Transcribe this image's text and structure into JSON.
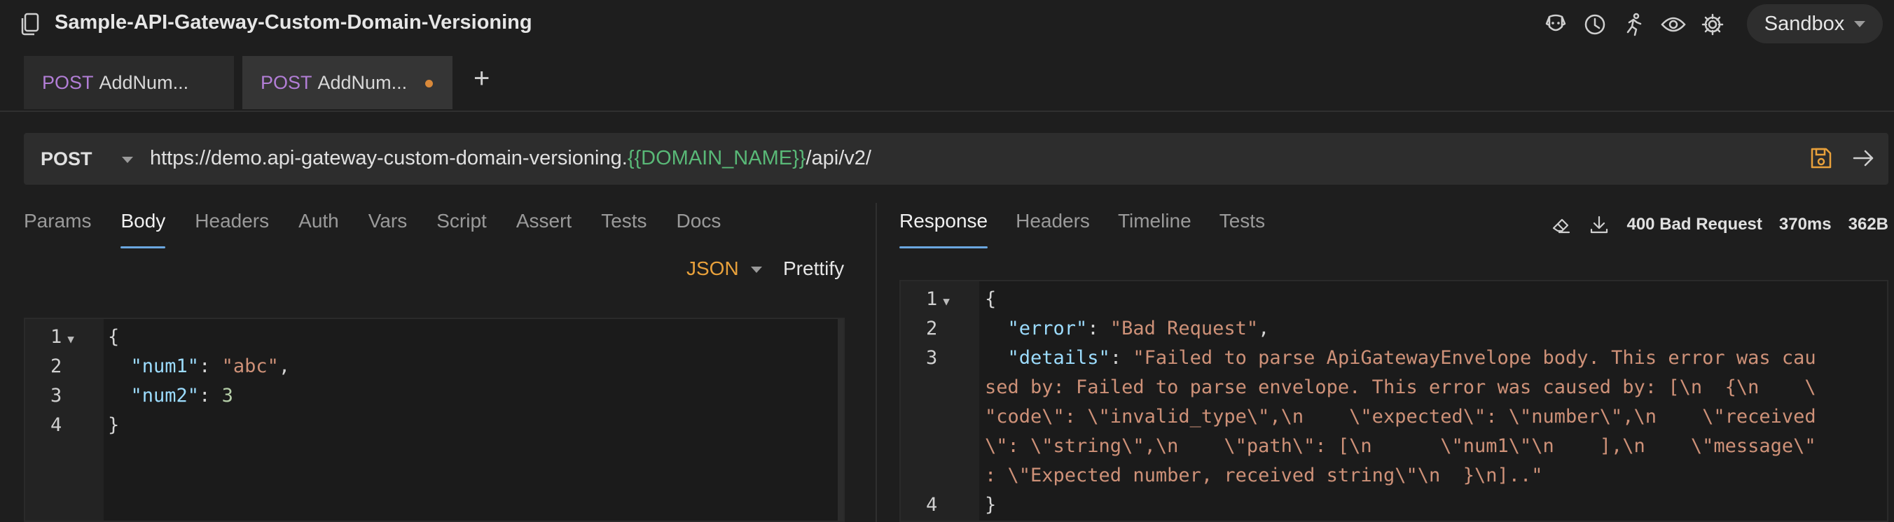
{
  "collection": {
    "title": "Sample-API-Gateway-Custom-Domain-Versioning"
  },
  "header_icons": [
    "dog-icon",
    "clock-icon",
    "runner-icon",
    "eye-icon",
    "gear-icon"
  ],
  "environment": {
    "selected": "Sandbox"
  },
  "tabs": [
    {
      "method": "POST",
      "name": "AddNum...",
      "active": false,
      "unsaved": false
    },
    {
      "method": "POST",
      "name": "AddNum...",
      "active": true,
      "unsaved": true
    }
  ],
  "request": {
    "method": "POST",
    "url_prefix": "https://demo.api-gateway-custom-domain-versioning.",
    "url_variable": "{{DOMAIN_NAME}}",
    "url_suffix": "/api/v2/"
  },
  "request_tabs": [
    "Params",
    "Body",
    "Headers",
    "Auth",
    "Vars",
    "Script",
    "Assert",
    "Tests",
    "Docs"
  ],
  "active_request_tab": "Body",
  "body": {
    "mode": "JSON",
    "prettify_label": "Prettify",
    "line_numbers": [
      "1",
      "2",
      "3",
      "4"
    ],
    "lines": {
      "l1": "{",
      "l2_key": "\"num1\"",
      "l2_colon": ": ",
      "l2_val": "\"abc\"",
      "l2_tail": ",",
      "l3_key": "\"num2\"",
      "l3_colon": ": ",
      "l3_val": "3",
      "l4": "}"
    }
  },
  "response_tabs": [
    "Response",
    "Headers",
    "Timeline",
    "Tests"
  ],
  "active_response_tab": "Response",
  "response_meta": {
    "status": "400 Bad Request",
    "time": "370ms",
    "size": "362B"
  },
  "response_body": {
    "line_numbers": [
      "1",
      "2",
      "3",
      "4"
    ],
    "l1": "{",
    "l2_key": "\"error\"",
    "l2_val": "\"Bad Request\"",
    "l3_key": "\"details\"",
    "l3_val_1": "\"Failed to parse ApiGatewayEnvelope body. This error was cau",
    "l3_val_2": "sed by: Failed to parse envelope. This error was caused by: [\\n  {\\n    \\",
    "l3_val_3": "\"code\\\": \\\"invalid_type\\\",\\n    \\\"expected\\\": \\\"number\\\",\\n    \\\"received",
    "l3_val_4": "\\\": \\\"string\\\",\\n    \\\"path\\\": [\\n      \\\"num1\\\"\\n    ],\\n    \\\"message\\\"",
    "l3_val_5": ": \\\"Expected number, received string\\\"\\n  }\\n]..\"",
    "l4": "}"
  }
}
